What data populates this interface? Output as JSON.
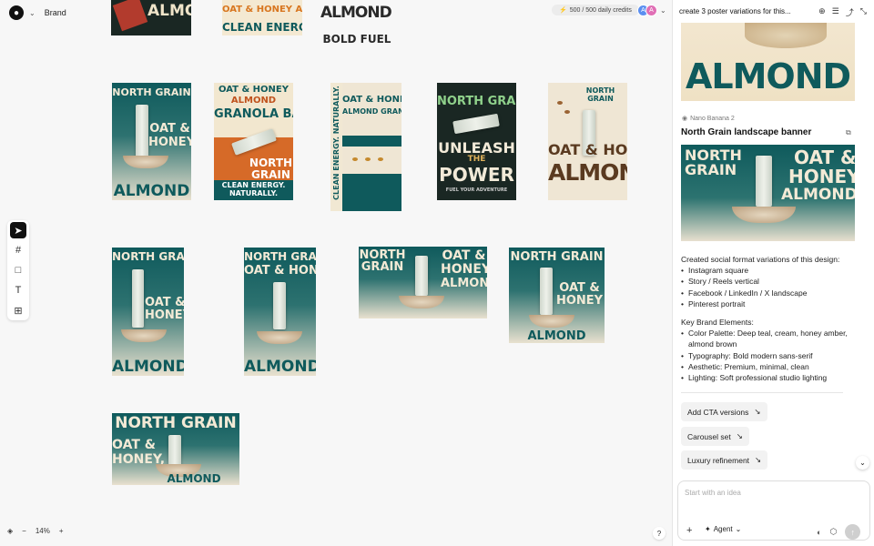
{
  "header": {
    "brand_label": "Brand",
    "credits": "500 / 500 daily credits",
    "avatar1": "A",
    "avatar2": "A"
  },
  "posters": {
    "top_row": [
      "ALMOND",
      "OAT & HONEY ALMOND",
      "CLEAN ENERGY",
      "ALMOND GRANOLA",
      "BOLD FUEL"
    ],
    "row2": {
      "p1": {
        "brand": "NORTH GRAIN",
        "flavor1": "OAT &",
        "flavor2": "HONEY",
        "bottom": "ALMOND"
      },
      "p2": {
        "top1": "OAT & HONEY",
        "top2": "ALMOND",
        "top3": "GRANOLA BAR",
        "mid1": "NORTH",
        "mid2": "GRAIN",
        "bottom1": "CLEAN ENERGY.",
        "bottom2": "NATURALLY."
      },
      "p3": {
        "side": "CLEAN ENERGY. NATURALLY.",
        "top1": "OAT & HONEY",
        "top2": "ALMOND GRANOLA"
      },
      "p4": {
        "brand": "NORTH GRAIN",
        "line1": "UNLEASH",
        "line2": "THE",
        "line3": "POWER",
        "tag": "FUEL YOUR ADVENTURE"
      },
      "p5": {
        "brand1": "NORTH",
        "brand2": "GRAIN",
        "line1": "OAT & HONEY",
        "line2": "ALMOND"
      }
    },
    "row3": {
      "p1": {
        "brand": "NORTH GRAIN",
        "flavor1": "OAT &",
        "flavor2": "HONEY",
        "bottom": "ALMOND"
      },
      "p2": {
        "brand": "NORTH GRAIN",
        "flavor": "OAT & HONEY",
        "bottom": "ALMOND"
      },
      "p3": {
        "brand1": "NORTH",
        "brand2": "GRAIN",
        "flavor1": "OAT &",
        "flavor2": "HONEY",
        "flavor3": "ALMOND"
      },
      "p4": {
        "brand": "NORTH GRAIN",
        "flavor1": "OAT &",
        "flavor2": "HONEY",
        "bottom": "ALMOND"
      }
    },
    "row4": {
      "p1": {
        "brand": "NORTH GRAIN",
        "flavor1": "OAT &",
        "flavor2": "HONEY,",
        "bottom": "ALMOND"
      }
    }
  },
  "tools": [
    "select-tool",
    "frame-tool",
    "rectangle-tool",
    "text-tool",
    "insert-tool"
  ],
  "zoom": {
    "minus": "−",
    "level": "14%",
    "plus": "+"
  },
  "help": "?",
  "panel": {
    "title": "create 3 poster variations for this...",
    "top_image_text": "ALMOND",
    "model": "Nano Banana 2",
    "image_title": "North Grain landscape banner",
    "banner": {
      "brand1": "NORTH",
      "brand2": "GRAIN",
      "flavor1": "OAT &",
      "flavor2": "HONEY",
      "flavor3": "ALMOND"
    },
    "msg1_intro": "Created social format variations of this design:",
    "msg1_items": [
      "Instagram square",
      "Story / Reels vertical",
      "Facebook / LinkedIn / X landscape",
      "Pinterest portrait"
    ],
    "msg2_intro": "Key Brand Elements:",
    "msg2_items": [
      "Color Palette: Deep teal, cream, honey amber, almond brown",
      "Typography: Bold modern sans-serif",
      "Aesthetic: Premium, minimal, clean",
      "Lighting: Soft professional studio lighting"
    ],
    "suggestions": [
      "Add CTA versions",
      "Carousel set",
      "Luxury refinement"
    ],
    "composer_placeholder": "Start with an idea",
    "agent_label": "Agent"
  },
  "colors": {
    "teal": "#0f5a5c",
    "cream": "#efe6d4",
    "honey": "#d9a441",
    "almond": "#9a6333"
  }
}
